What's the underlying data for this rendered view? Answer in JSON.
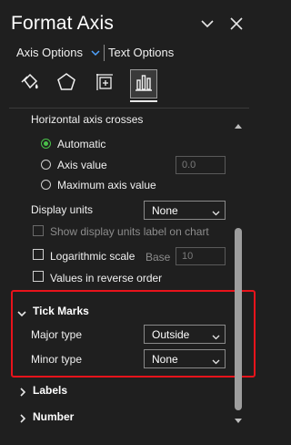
{
  "header": {
    "title": "Format Axis",
    "collapse_icon": "chevron-down-icon",
    "close_icon": "close-icon"
  },
  "tabs": {
    "axis_options": "Axis Options",
    "text_options": "Text Options"
  },
  "icon_tabs": [
    {
      "name": "fill-line-icon",
      "active": false
    },
    {
      "name": "effects-icon",
      "active": false
    },
    {
      "name": "size-properties-icon",
      "active": false
    },
    {
      "name": "axis-options-icon",
      "active": true
    }
  ],
  "axis_crosses": {
    "label": "Horizontal axis crosses",
    "automatic": "Automatic",
    "axis_value": "Axis value",
    "axis_value_input": "0.0",
    "maximum": "Maximum axis value",
    "selected": "automatic"
  },
  "display_units": {
    "label": "Display units",
    "value": "None",
    "show_label": "Show display units label on chart"
  },
  "log_scale": {
    "label": "Logarithmic scale",
    "base_label": "Base",
    "base_value": "10"
  },
  "reverse_order": {
    "label": "Values in reverse order"
  },
  "tick_marks": {
    "heading": "Tick Marks",
    "major_label": "Major type",
    "major_value": "Outside",
    "minor_label": "Minor type",
    "minor_value": "None"
  },
  "sections": {
    "labels": "Labels",
    "number": "Number"
  },
  "colors": {
    "background": "#1f1f1f",
    "accent_green": "#4ac04a",
    "highlight_red": "#e8131b",
    "link_blue": "#4fa3ff"
  }
}
